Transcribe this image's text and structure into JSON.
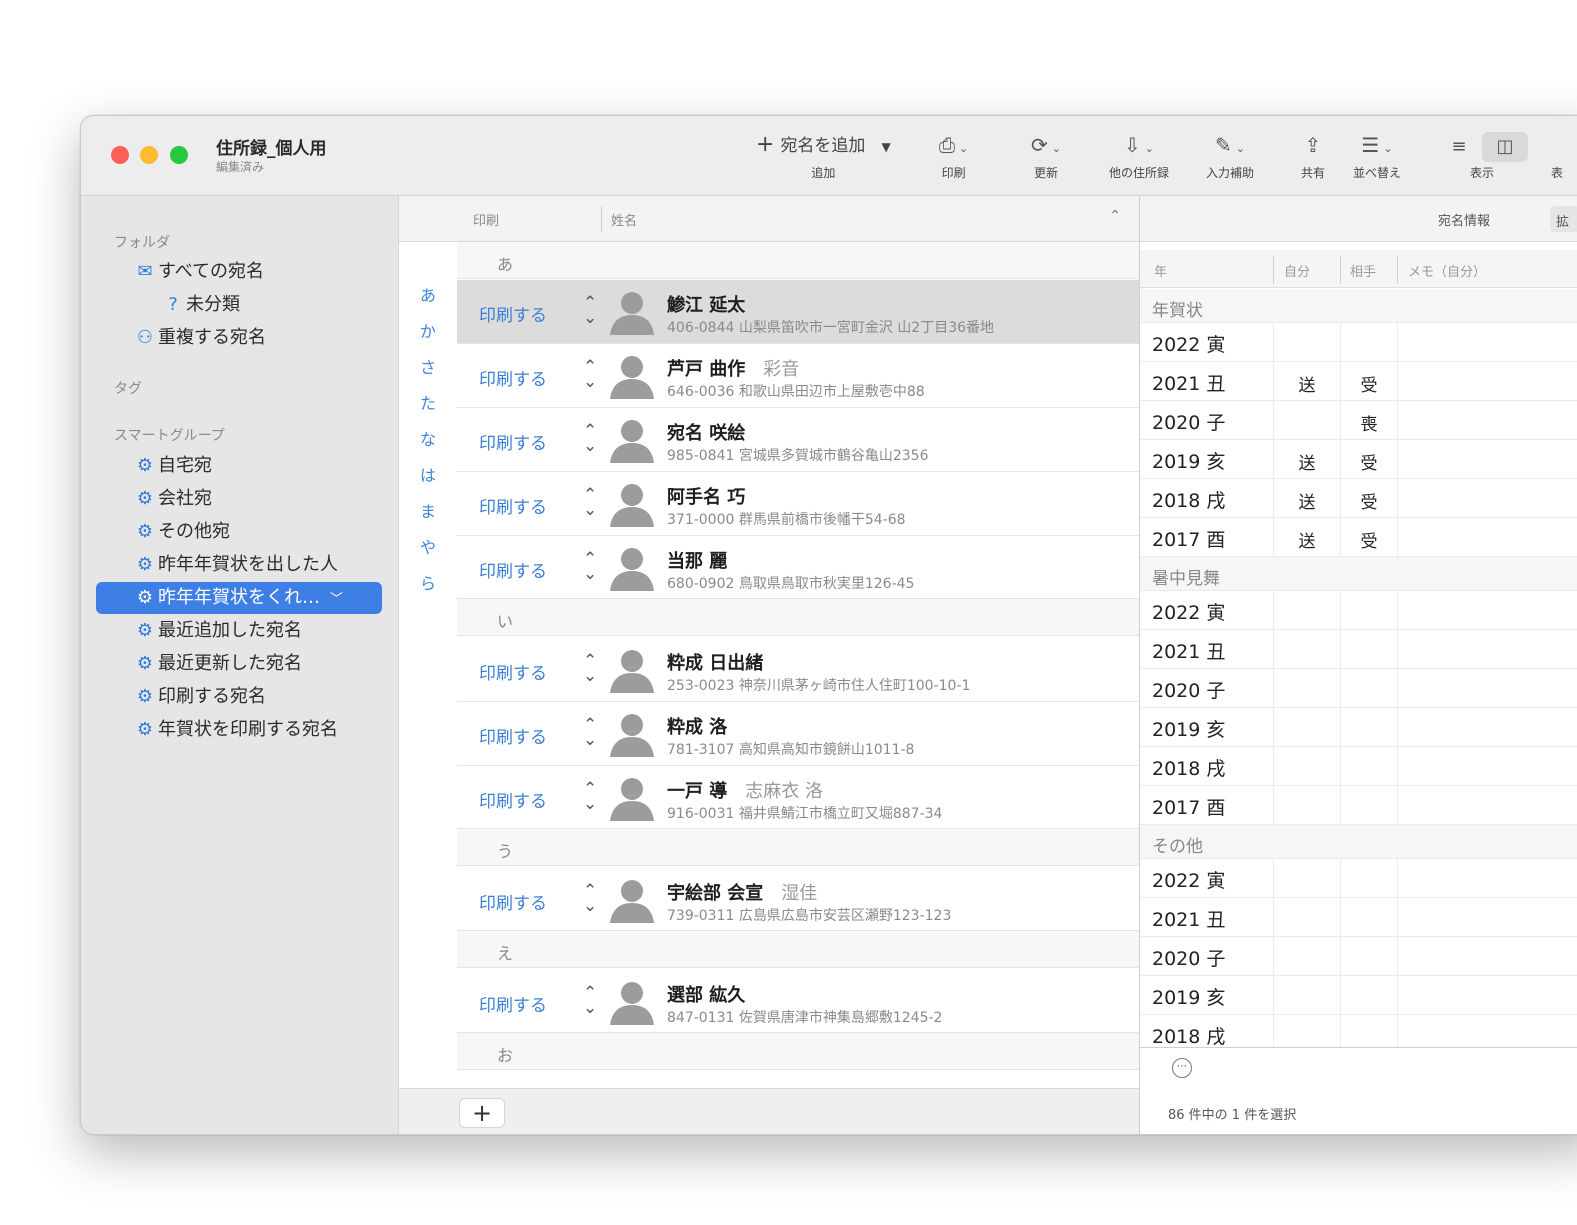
{
  "window": {
    "title": "住所録_個人用",
    "subtitle": "編集済み"
  },
  "toolbar": {
    "add_button": "宛名を追加",
    "add_label": "追加",
    "print_label": "印刷",
    "refresh_label": "更新",
    "other_label": "他の住所録",
    "input_label": "入力補助",
    "share_label": "共有",
    "sort_label": "並べ替え",
    "view_label": "表示",
    "extra_label": "表"
  },
  "sidebar": {
    "folder_heading": "フォルダ",
    "tag_heading": "タグ",
    "smart_heading": "スマートグループ",
    "folders": [
      "すべての宛名",
      "未分類",
      "重複する宛名"
    ],
    "smart_groups": [
      "自宅宛",
      "会社宛",
      "その他宛",
      "昨年年賀状を出した人",
      "昨年年賀状をくれ…",
      "最近追加した宛名",
      "最近更新した宛名",
      "印刷する宛名",
      "年賀状を印刷する宛名"
    ]
  },
  "list": {
    "col_print": "印刷",
    "col_name": "姓名",
    "index": [
      "あ",
      "か",
      "さ",
      "た",
      "な",
      "は",
      "ま",
      "や",
      "ら"
    ],
    "sections": [
      "あ",
      "い",
      "う",
      "え",
      "お"
    ],
    "print_text": "印刷する",
    "rows": [
      {
        "name": "鯵江 延太",
        "alt": "",
        "addr": "406-0844 山梨県笛吹市一宮町金沢 山2丁目36番地"
      },
      {
        "name": "芦戸 曲作",
        "alt": "彩音",
        "addr": "646-0036 和歌山県田辺市上屋敷壱中88"
      },
      {
        "name": "宛名 咲絵",
        "alt": "",
        "addr": "985-0841 宮城県多賀城市鶴谷亀山2356"
      },
      {
        "name": "阿手名 巧",
        "alt": "",
        "addr": "371-0000 群馬県前橋市後幡干54-68"
      },
      {
        "name": "当那 麗",
        "alt": "",
        "addr": "680-0902 鳥取県鳥取市秋実里126-45"
      },
      {
        "name": "粋成 日出緒",
        "alt": "",
        "addr": "253-0023 神奈川県茅ヶ崎市住人住町100-10-1"
      },
      {
        "name": "粋成 洛",
        "alt": "",
        "addr": "781-3107 高知県高知市鏡餅山1011-8"
      },
      {
        "name": "一戸 導",
        "alt": "志麻衣 洛",
        "addr": "916-0031 福井県鯖江市橋立町又堀887-34"
      },
      {
        "name": "宇絵部 会宣",
        "alt": "湿佳",
        "addr": "739-0311 広島県広島市安芸区瀬野123-123"
      },
      {
        "name": "選部 紘久",
        "alt": "",
        "addr": "847-0131 佐賀県唐津市神集島郷敷1245-2"
      }
    ]
  },
  "info": {
    "title": "宛名情報",
    "tab2": "拡",
    "col_year": "年",
    "col_self": "自分",
    "col_other": "相手",
    "col_memo": "メモ（自分）",
    "categories": [
      {
        "name": "年賀状",
        "years": [
          {
            "year": "2022 寅",
            "self": "",
            "other": ""
          },
          {
            "year": "2021 丑",
            "self": "送",
            "other": "受"
          },
          {
            "year": "2020 子",
            "self": "",
            "other": "喪"
          },
          {
            "year": "2019 亥",
            "self": "送",
            "other": "受"
          },
          {
            "year": "2018 戌",
            "self": "送",
            "other": "受"
          },
          {
            "year": "2017 酉",
            "self": "送",
            "other": "受"
          }
        ]
      },
      {
        "name": "暑中見舞",
        "years": [
          {
            "year": "2022 寅",
            "self": "",
            "other": ""
          },
          {
            "year": "2021 丑",
            "self": "",
            "other": ""
          },
          {
            "year": "2020 子",
            "self": "",
            "other": ""
          },
          {
            "year": "2019 亥",
            "self": "",
            "other": ""
          },
          {
            "year": "2018 戌",
            "self": "",
            "other": ""
          },
          {
            "year": "2017 酉",
            "self": "",
            "other": ""
          }
        ]
      },
      {
        "name": "その他",
        "years": [
          {
            "year": "2022 寅",
            "self": "",
            "other": ""
          },
          {
            "year": "2021 丑",
            "self": "",
            "other": ""
          },
          {
            "year": "2020 子",
            "self": "",
            "other": ""
          },
          {
            "year": "2019 亥",
            "self": "",
            "other": ""
          },
          {
            "year": "2018 戌",
            "self": "",
            "other": ""
          }
        ]
      }
    ],
    "more_icon": "ellipsis-icon",
    "status": "86 件中の 1 件を選択"
  },
  "colors": {
    "accent": "#3e7fe6",
    "link": "#3a7fd5"
  }
}
